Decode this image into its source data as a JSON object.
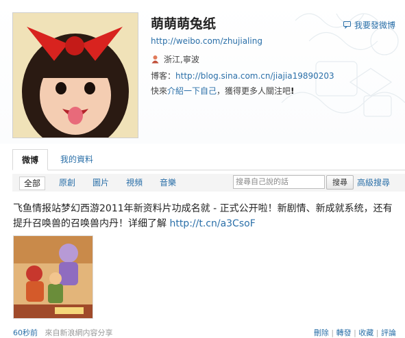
{
  "profile": {
    "nickname": "萌萌萌兔纸",
    "url": "http://weibo.com/zhujialing",
    "location": "浙江,寧波",
    "blog_label": "博客：",
    "blog_url": "http://blog.sina.com.cn/jiajia19890203",
    "intro_prefix": "快來",
    "intro_link": "介紹一下自己",
    "intro_suffix": "，獲得更多人關注吧",
    "intro_mark": "!"
  },
  "header": {
    "feedback_label": "我要發微博"
  },
  "tabs": [
    {
      "label": "微博"
    },
    {
      "label": "我的資料"
    }
  ],
  "filter": {
    "items": [
      "全部",
      "原創",
      "圖片",
      "視頻",
      "音樂"
    ],
    "search_placeholder": "搜尋自己說的話",
    "search_button": "搜尋",
    "advanced": "高級搜尋"
  },
  "post": {
    "text": "飞鱼情报站梦幻西游2011年新资料片功成名就 - 正式公开啦！新剧情、新成就系统，还有提升召唤兽的召唤兽内丹！详细了解 ",
    "link": "http://t.cn/a3CsoF"
  },
  "meta": {
    "time": "60秒前",
    "source": "來自新浪網内容分享",
    "actions": [
      "刪除",
      "轉發",
      "收藏",
      "評論"
    ]
  },
  "colors": {
    "link": "#2a6fa8",
    "tab_bg": "#f4f4f4"
  }
}
